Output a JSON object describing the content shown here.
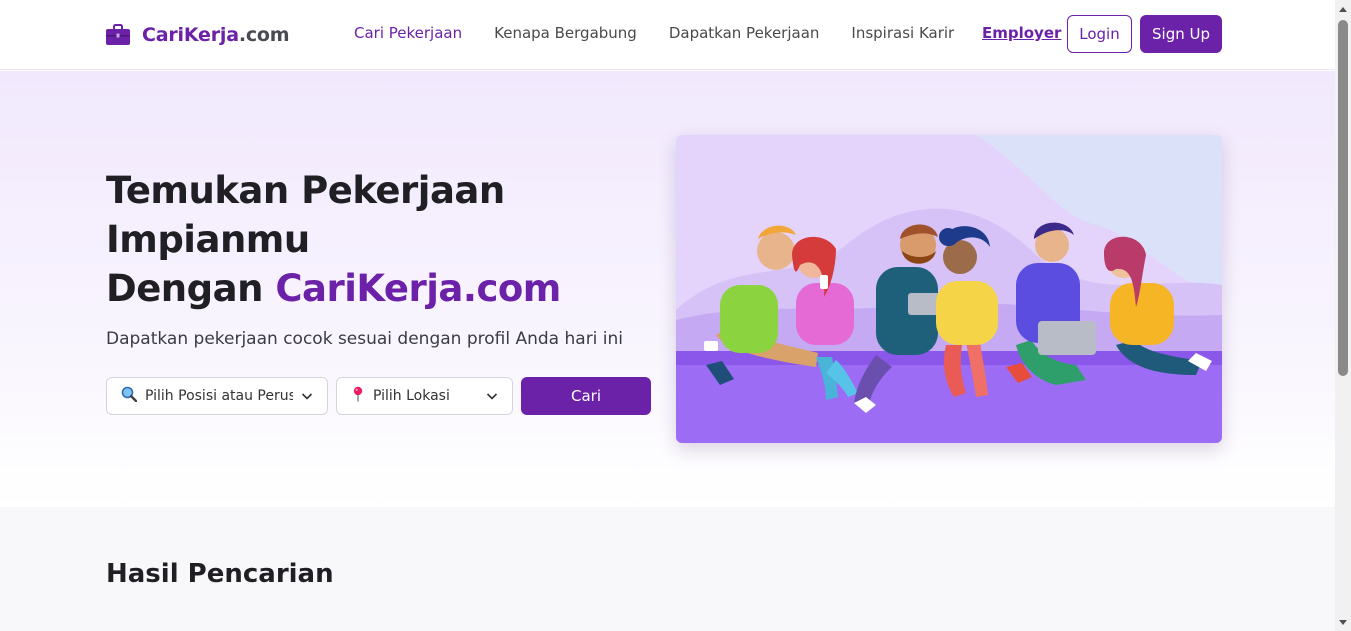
{
  "header": {
    "brand_name": "CariKerja",
    "brand_suffix": ".com",
    "nav": [
      "Cari Pekerjaan",
      "Kenapa Bergabung",
      "Dapatkan Pekerjaan",
      "Inspirasi Karir"
    ],
    "employer_label": "Employer",
    "login_label": "Login",
    "signup_label": "Sign Up"
  },
  "hero": {
    "title_line1": "Temukan Pekerjaan",
    "title_line2": "Impianmu",
    "title_line3_prefix": "Dengan ",
    "title_line3_accent": "CariKerja.com",
    "subtitle": "Dapatkan pekerjaan cocok sesuai dengan profil Anda hari ini",
    "position_select": "Pilih Posisi atau Perusahaan",
    "location_select": "Pilih Lokasi",
    "search_label": "Cari"
  },
  "results": {
    "title": "Hasil Pencarian"
  },
  "colors": {
    "brand": "#6b21a8",
    "hero_bg": "#f1e8fd",
    "illustration_floor": "#9d6cf5"
  },
  "icons": {
    "brand": "briefcase-icon",
    "position": "search-icon",
    "location": "location-pin-icon"
  }
}
